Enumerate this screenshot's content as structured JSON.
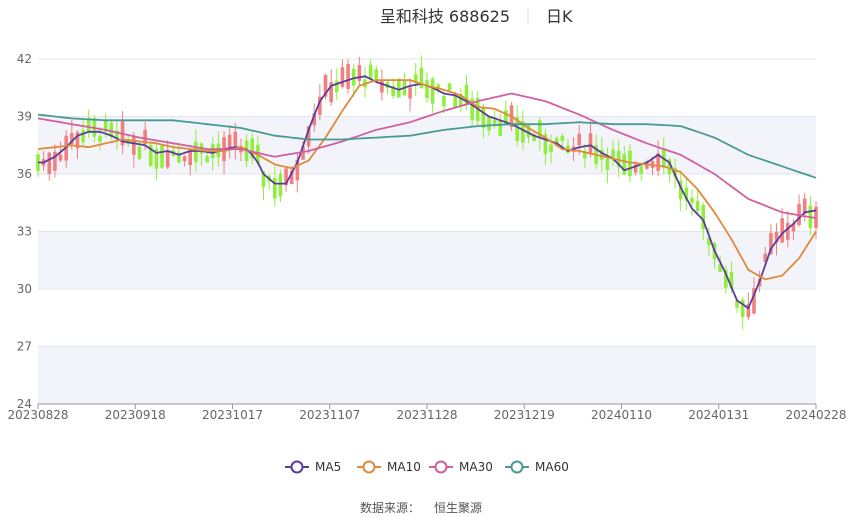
{
  "chart_data": {
    "type": "candlestick",
    "title": "呈和科技 688625",
    "subtitle": "日K",
    "ylim": [
      24,
      42
    ],
    "y_ticks": [
      24,
      27,
      30,
      33,
      36,
      39,
      42
    ],
    "x_ticks": [
      "20230828",
      "20230918",
      "20231017",
      "20231107",
      "20231128",
      "20231219",
      "20240110",
      "20240131",
      "20240228"
    ],
    "x_count": 120,
    "legend": [
      "MA5",
      "MA10",
      "MA30",
      "MA60"
    ],
    "legend_position": "bottom",
    "grid": true,
    "candle_colors": {
      "up": "#f08080",
      "down": "#90ee3c"
    },
    "series": [
      {
        "name": "MA5",
        "color": "#5b3c9b",
        "anchors": [
          [
            0,
            36.6
          ],
          [
            1,
            36.6
          ],
          [
            3,
            36.9
          ],
          [
            5,
            37.4
          ],
          [
            7,
            38.0
          ],
          [
            9,
            38.2
          ],
          [
            11,
            38.2
          ],
          [
            13,
            38.0
          ],
          [
            15,
            37.7
          ],
          [
            17,
            37.6
          ],
          [
            19,
            37.5
          ],
          [
            21,
            37.1
          ],
          [
            23,
            37.2
          ],
          [
            25,
            37.0
          ],
          [
            27,
            37.2
          ],
          [
            29,
            37.2
          ],
          [
            31,
            37.1
          ],
          [
            33,
            37.3
          ],
          [
            35,
            37.4
          ],
          [
            37,
            37.3
          ],
          [
            38,
            37.0
          ],
          [
            39,
            36.6
          ],
          [
            40,
            36.0
          ],
          [
            42,
            35.5
          ],
          [
            44,
            35.5
          ],
          [
            46,
            36.6
          ],
          [
            48,
            38.3
          ],
          [
            50,
            39.8
          ],
          [
            52,
            40.6
          ],
          [
            54,
            40.8
          ],
          [
            56,
            41.0
          ],
          [
            58,
            41.1
          ],
          [
            60,
            40.8
          ],
          [
            62,
            40.6
          ],
          [
            64,
            40.4
          ],
          [
            66,
            40.6
          ],
          [
            68,
            40.7
          ],
          [
            70,
            40.5
          ],
          [
            72,
            40.2
          ],
          [
            74,
            40.1
          ],
          [
            76,
            39.8
          ],
          [
            78,
            39.4
          ],
          [
            80,
            39.0
          ],
          [
            82,
            38.8
          ],
          [
            84,
            38.6
          ],
          [
            86,
            38.3
          ],
          [
            88,
            38.0
          ],
          [
            90,
            37.8
          ],
          [
            92,
            37.6
          ],
          [
            94,
            37.2
          ],
          [
            96,
            37.4
          ],
          [
            98,
            37.5
          ],
          [
            100,
            37.1
          ],
          [
            102,
            36.8
          ],
          [
            104,
            36.2
          ],
          [
            106,
            36.4
          ],
          [
            108,
            36.6
          ],
          [
            110,
            37.0
          ],
          [
            112,
            36.6
          ],
          [
            114,
            35.3
          ],
          [
            116,
            34.2
          ],
          [
            118,
            33.6
          ],
          [
            120,
            32.0
          ],
          [
            122,
            30.8
          ],
          [
            124,
            29.4
          ],
          [
            126,
            29.0
          ],
          [
            128,
            30.4
          ],
          [
            130,
            32.1
          ],
          [
            132,
            32.9
          ],
          [
            134,
            33.4
          ],
          [
            136,
            34.0
          ],
          [
            138,
            34.1
          ]
        ]
      },
      {
        "name": "MA10",
        "color": "#e08a3c",
        "anchors": [
          [
            0,
            37.3
          ],
          [
            3,
            37.4
          ],
          [
            6,
            37.5
          ],
          [
            9,
            37.4
          ],
          [
            12,
            37.6
          ],
          [
            15,
            37.8
          ],
          [
            18,
            37.7
          ],
          [
            21,
            37.6
          ],
          [
            24,
            37.4
          ],
          [
            27,
            37.3
          ],
          [
            30,
            37.2
          ],
          [
            33,
            37.2
          ],
          [
            36,
            37.4
          ],
          [
            39,
            37.0
          ],
          [
            42,
            36.5
          ],
          [
            45,
            36.3
          ],
          [
            48,
            36.7
          ],
          [
            51,
            37.9
          ],
          [
            54,
            39.3
          ],
          [
            57,
            40.6
          ],
          [
            60,
            40.9
          ],
          [
            63,
            40.9
          ],
          [
            66,
            40.9
          ],
          [
            69,
            40.6
          ],
          [
            72,
            40.4
          ],
          [
            75,
            40.1
          ],
          [
            78,
            39.5
          ],
          [
            81,
            39.4
          ],
          [
            84,
            39.0
          ],
          [
            87,
            38.4
          ],
          [
            90,
            37.9
          ],
          [
            93,
            37.3
          ],
          [
            96,
            37.2
          ],
          [
            99,
            37.0
          ],
          [
            102,
            36.8
          ],
          [
            105,
            36.6
          ],
          [
            108,
            36.5
          ],
          [
            111,
            36.4
          ],
          [
            114,
            36.1
          ],
          [
            117,
            35.2
          ],
          [
            120,
            34.0
          ],
          [
            123,
            32.6
          ],
          [
            126,
            31.0
          ],
          [
            129,
            30.5
          ],
          [
            132,
            30.7
          ],
          [
            135,
            31.6
          ],
          [
            138,
            33.0
          ]
        ]
      },
      {
        "name": "MA30",
        "color": "#d060a0",
        "anchors": [
          [
            0,
            38.9
          ],
          [
            6,
            38.6
          ],
          [
            12,
            38.3
          ],
          [
            18,
            37.9
          ],
          [
            24,
            37.6
          ],
          [
            30,
            37.3
          ],
          [
            36,
            37.3
          ],
          [
            42,
            36.9
          ],
          [
            48,
            37.2
          ],
          [
            54,
            37.7
          ],
          [
            60,
            38.3
          ],
          [
            66,
            38.7
          ],
          [
            72,
            39.3
          ],
          [
            78,
            39.8
          ],
          [
            84,
            40.2
          ],
          [
            90,
            39.8
          ],
          [
            96,
            39.1
          ],
          [
            102,
            38.3
          ],
          [
            108,
            37.6
          ],
          [
            114,
            37.0
          ],
          [
            120,
            36.0
          ],
          [
            126,
            34.7
          ],
          [
            132,
            34.0
          ],
          [
            138,
            33.7
          ]
        ]
      },
      {
        "name": "MA60",
        "color": "#4a9a94",
        "anchors": [
          [
            0,
            39.1
          ],
          [
            6,
            38.9
          ],
          [
            12,
            38.8
          ],
          [
            18,
            38.8
          ],
          [
            24,
            38.8
          ],
          [
            30,
            38.6
          ],
          [
            36,
            38.4
          ],
          [
            42,
            38.0
          ],
          [
            48,
            37.8
          ],
          [
            54,
            37.8
          ],
          [
            60,
            37.9
          ],
          [
            66,
            38.0
          ],
          [
            72,
            38.3
          ],
          [
            78,
            38.5
          ],
          [
            84,
            38.6
          ],
          [
            90,
            38.6
          ],
          [
            96,
            38.7
          ],
          [
            102,
            38.6
          ],
          [
            108,
            38.6
          ],
          [
            114,
            38.5
          ],
          [
            120,
            37.9
          ],
          [
            126,
            37.0
          ],
          [
            132,
            36.4
          ],
          [
            138,
            35.8
          ]
        ]
      }
    ]
  },
  "source": {
    "label": "数据来源：",
    "name": "恒生聚源"
  }
}
